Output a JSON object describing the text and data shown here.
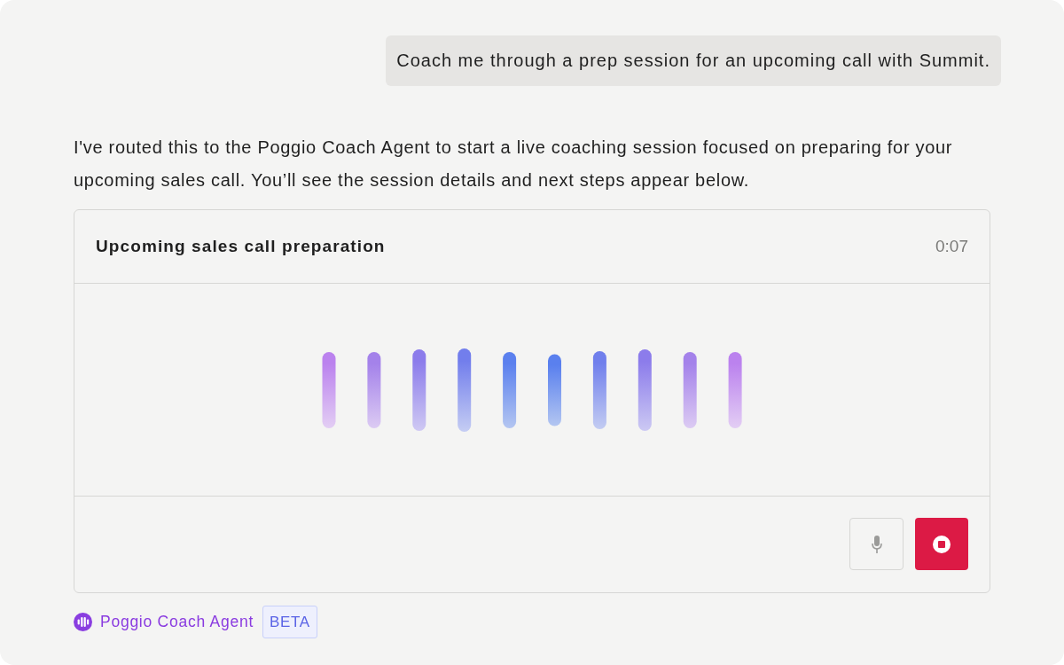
{
  "user_message": {
    "text": "Coach me through a prep session for an upcoming call with Summit."
  },
  "assistant_message": {
    "text": "I've routed this to the Poggio Coach Agent to start a live coaching session focused on preparing for your upcoming sales call. You’ll see the session details and next steps appear below."
  },
  "session_card": {
    "title": "Upcoming sales call preparation",
    "timer": "0:07",
    "buttons": [
      {
        "kind": "mic"
      },
      {
        "kind": "stop"
      }
    ]
  },
  "agent": {
    "name": "Poggio Coach Agent",
    "badge": "BETA"
  }
}
